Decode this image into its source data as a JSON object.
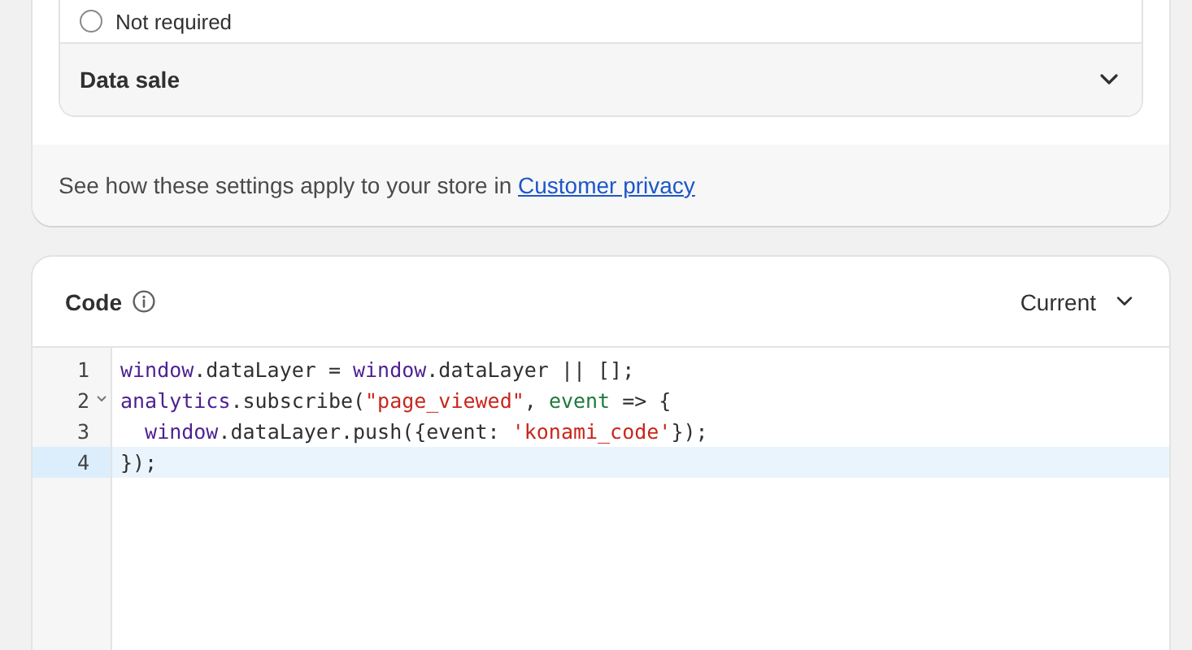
{
  "consent_options": [
    {
      "label": "Not required",
      "selected": false
    }
  ],
  "sections": [
    {
      "title": "Data sale",
      "expanded": false
    }
  ],
  "footer": {
    "text": "See how these settings apply to your store in",
    "link": "Customer privacy"
  },
  "code_card": {
    "title": "Code",
    "version": "Current",
    "lines": [
      {
        "number": "1",
        "foldable": false,
        "active": false,
        "tokens": [
          {
            "kind": "keyword",
            "text": "window"
          },
          {
            "kind": "plain",
            "text": ".dataLayer = "
          },
          {
            "kind": "keyword",
            "text": "window"
          },
          {
            "kind": "plain",
            "text": ".dataLayer || [];"
          }
        ]
      },
      {
        "number": "2",
        "foldable": true,
        "active": false,
        "tokens": [
          {
            "kind": "keyword",
            "text": "analytics"
          },
          {
            "kind": "plain",
            "text": ".subscribe("
          },
          {
            "kind": "string",
            "text": "\"page_viewed\""
          },
          {
            "kind": "plain",
            "text": ", "
          },
          {
            "kind": "param",
            "text": "event"
          },
          {
            "kind": "plain",
            "text": " => {"
          }
        ]
      },
      {
        "number": "3",
        "foldable": false,
        "active": false,
        "tokens": [
          {
            "kind": "keyword",
            "text": "  window"
          },
          {
            "kind": "plain",
            "text": ".dataLayer.push({event: "
          },
          {
            "kind": "string",
            "text": "'konami_code'"
          },
          {
            "kind": "plain",
            "text": "});"
          }
        ]
      },
      {
        "number": "4",
        "foldable": false,
        "active": true,
        "tokens": [
          {
            "kind": "plain",
            "text": "});"
          }
        ]
      }
    ]
  }
}
